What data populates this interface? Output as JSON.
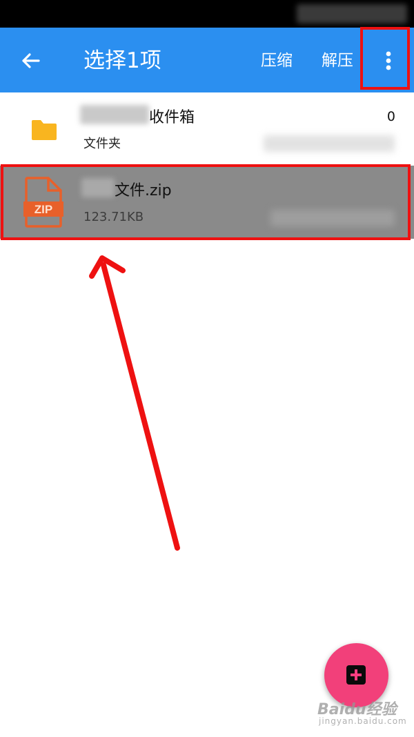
{
  "header": {
    "title": "选择1项",
    "actions": {
      "compress": "压缩",
      "extract": "解压"
    },
    "icons": {
      "back": "back-arrow-icon",
      "more": "more-vert-icon"
    }
  },
  "files": [
    {
      "name_visible": "收件箱",
      "subtitle": "文件夹",
      "count": "0",
      "icon": "folder-icon",
      "selected": false
    },
    {
      "name_visible": "文件.zip",
      "subtitle": "123.71KB",
      "icon": "zip-file-icon",
      "icon_label": "ZIP",
      "selected": true
    }
  ],
  "fab": {
    "icon": "add-icon"
  },
  "watermark": {
    "line1": "Baidu经验",
    "line2": "jingyan.baidu.com"
  },
  "colors": {
    "app_bar": "#2b8ff0",
    "selected_row": "#8a8a8a",
    "highlight": "#ee1111",
    "fab": "#f2407a",
    "zip_icon": "#e8602a",
    "folder_icon": "#f9b51f"
  }
}
